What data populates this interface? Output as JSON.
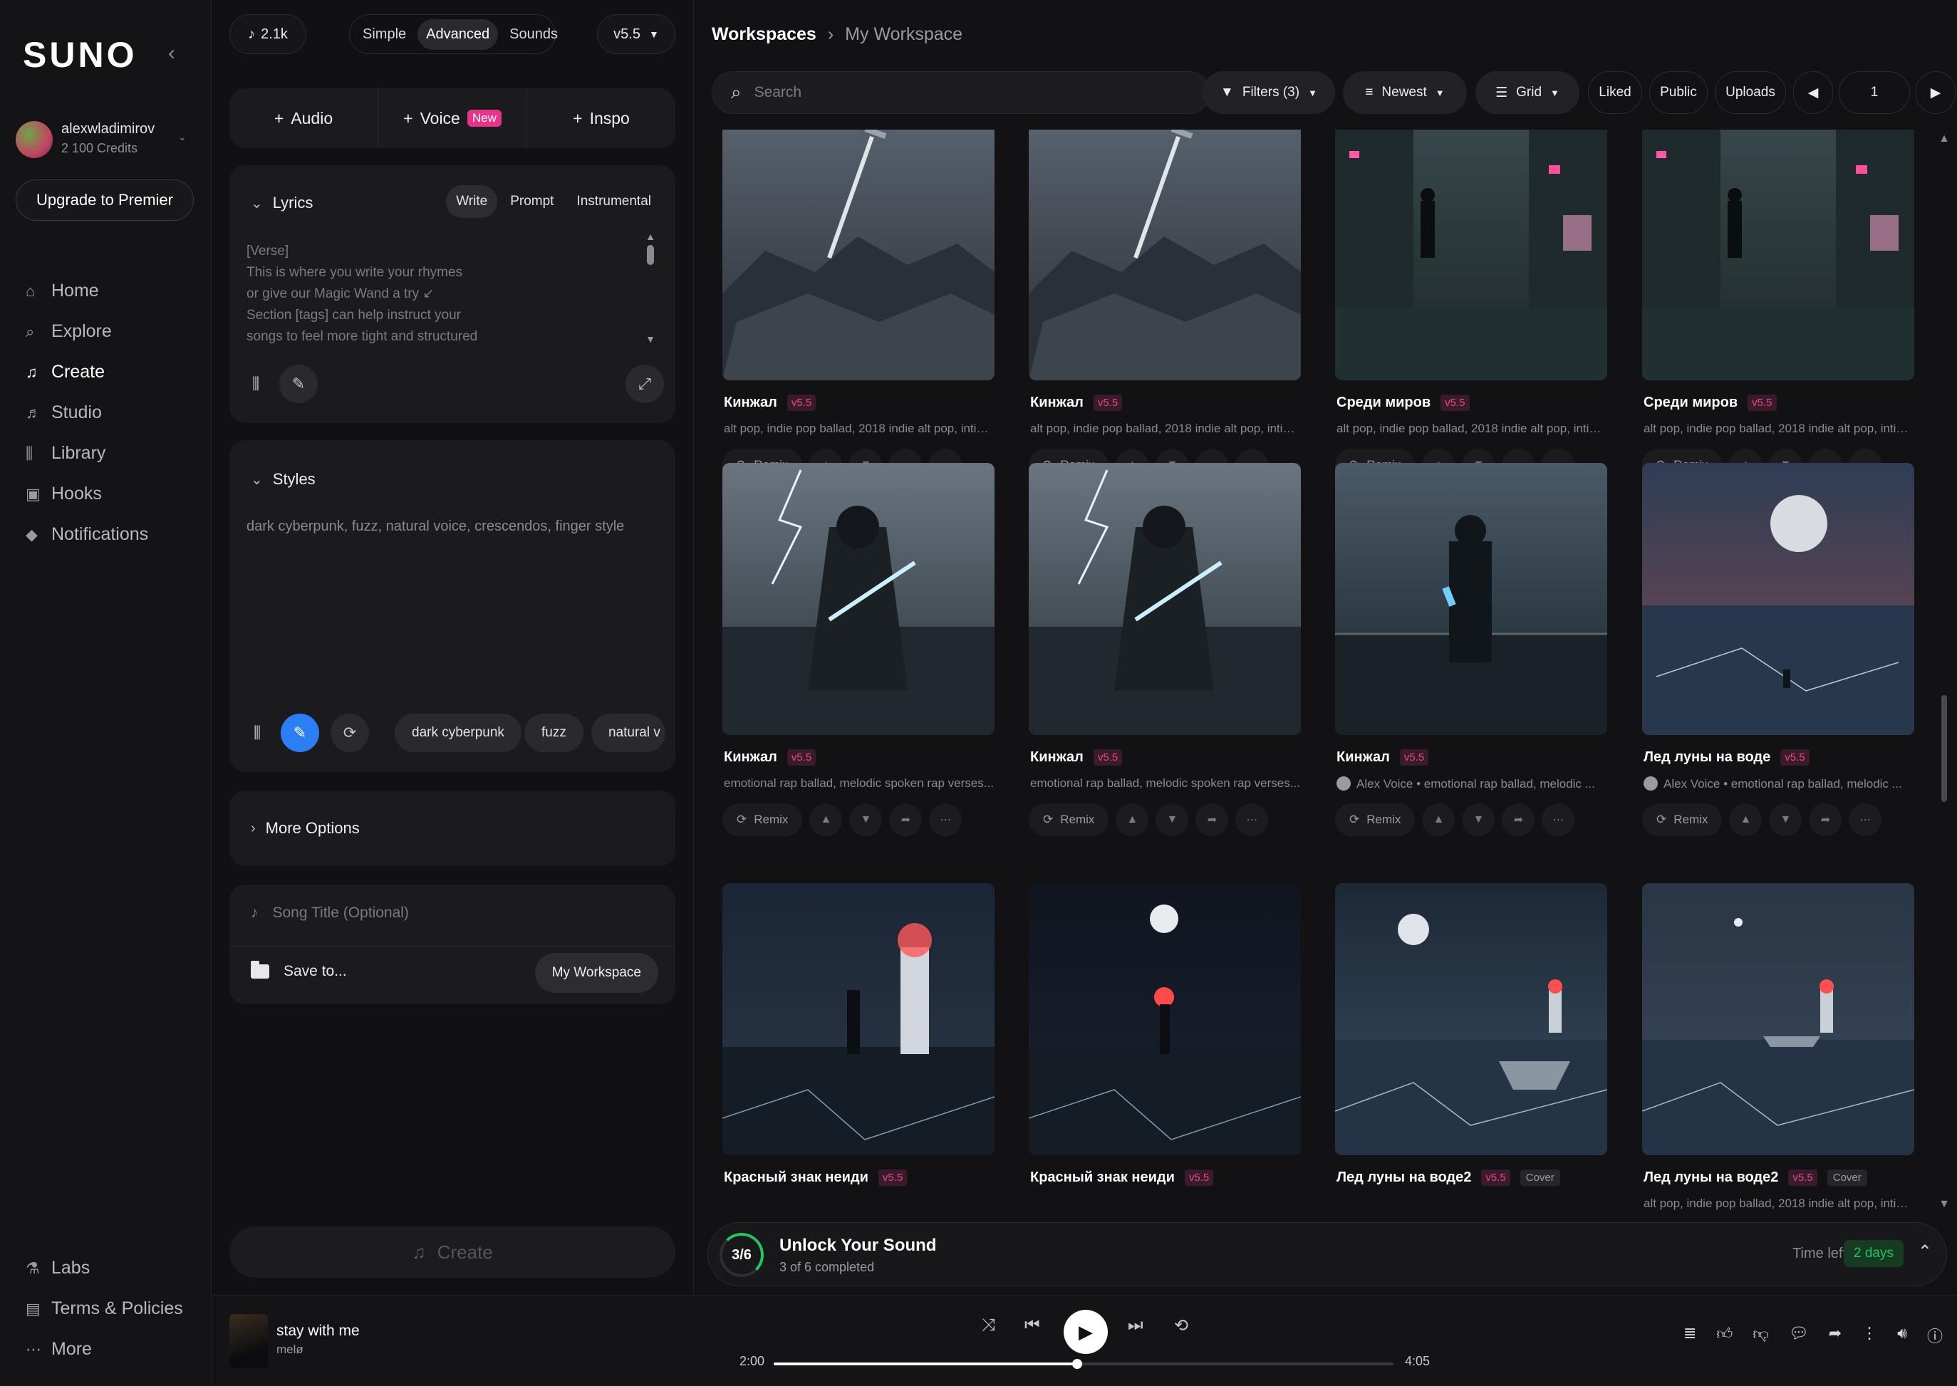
{
  "brand": {
    "logo": "SUNO"
  },
  "user": {
    "name": "alexwladimirov",
    "credits": "2 100 Credits"
  },
  "upgrade_label": "Upgrade to Premier",
  "nav": {
    "items": [
      {
        "label": "Home",
        "icon": "home-icon"
      },
      {
        "label": "Explore",
        "icon": "search-icon"
      },
      {
        "label": "Create",
        "icon": "music-note-icon"
      },
      {
        "label": "Studio",
        "icon": "studio-icon"
      },
      {
        "label": "Library",
        "icon": "library-icon"
      },
      {
        "label": "Hooks",
        "icon": "hooks-icon"
      },
      {
        "label": "Notifications",
        "icon": "bell-icon"
      }
    ],
    "bottom": [
      {
        "label": "Labs",
        "icon": "flask-icon"
      },
      {
        "label": "Terms & Policies",
        "icon": "document-icon"
      },
      {
        "label": "More",
        "icon": "more-icon"
      }
    ]
  },
  "create": {
    "count_badge": "2.1k",
    "modes": [
      "Simple",
      "Advanced",
      "Sounds"
    ],
    "active_mode": "Advanced",
    "version": "v5.5",
    "add": {
      "audio": "Audio",
      "voice": "Voice",
      "voice_badge": "New",
      "inspo": "Inspo"
    },
    "lyrics": {
      "title": "Lyrics",
      "tabs": [
        "Write",
        "Prompt",
        "Instrumental"
      ],
      "placeholder": "[Verse]\nThis is where you write your rhymes\nor give our Magic Wand a try ↙\nSection [tags] can help instruct your\nsongs to feel more tight and structured"
    },
    "styles": {
      "title": "Styles",
      "placeholder": "dark cyberpunk, fuzz, natural voice, crescendos, finger style",
      "chips": [
        "dark cyberpunk",
        "fuzz",
        "natural v"
      ]
    },
    "more_options": "More Options",
    "song_title_placeholder": "Song Title (Optional)",
    "save_to": "Save to...",
    "workspace": "My Workspace",
    "create_button": "Create"
  },
  "workspace": {
    "breadcrumb": [
      "Workspaces",
      "My Workspace"
    ],
    "search_placeholder": "Search",
    "filters": "Filters (3)",
    "sort": "Newest",
    "view": "Grid",
    "liked": "Liked",
    "public": "Public",
    "uploads": "Uploads",
    "page": "1",
    "remix_label": "Remix",
    "songs": [
      {
        "title": "Кинжал",
        "version": "v5.5",
        "desc": "alt pop, indie pop ballad, 2018 indie alt pop, intim...",
        "scene": "sword"
      },
      {
        "title": "Кинжал",
        "version": "v5.5",
        "desc": "alt pop, indie pop ballad, 2018 indie alt pop, intim...",
        "scene": "sword"
      },
      {
        "title": "Среди миров",
        "version": "v5.5",
        "desc": "alt pop, indie pop ballad, 2018 indie alt pop, intim...",
        "scene": "street"
      },
      {
        "title": "Среди миров",
        "version": "v5.5",
        "desc": "alt pop, indie pop ballad, 2018 indie alt pop, intim...",
        "scene": "street"
      },
      {
        "title": "Кинжал",
        "version": "v5.5",
        "desc": "emotional rap ballad, melodic spoken rap verses...",
        "scene": "hood"
      },
      {
        "title": "Кинжал",
        "version": "v5.5",
        "desc": "emotional rap ballad, melodic spoken rap verses...",
        "scene": "hood"
      },
      {
        "title": "Кинжал",
        "version": "v5.5",
        "voice": "Alex Voice",
        "desc": "emotional rap ballad, melodic ...",
        "scene": "glass"
      },
      {
        "title": "Лед луны на воде",
        "version": "v5.5",
        "voice": "Alex Voice",
        "desc": "emotional rap ballad, melodic ...",
        "scene": "moon"
      },
      {
        "title": "Красный знак неиди",
        "version": "v5.5",
        "desc": "",
        "scene": "lighthouse"
      },
      {
        "title": "Красный знак неиди",
        "version": "v5.5",
        "desc": "",
        "scene": "lighthouse2"
      },
      {
        "title": "Лед луны на воде2",
        "version": "v5.5",
        "cover": "Cover",
        "desc": "",
        "scene": "boat"
      },
      {
        "title": "Лед луны на воде2",
        "version": "v5.5",
        "cover": "Cover",
        "desc": "alt pop, indie pop ballad, 2018 indie alt pop, intim...",
        "scene": "pier"
      }
    ]
  },
  "unlock": {
    "progress": "3/6",
    "title": "Unlock Your Sound",
    "subtitle": "3 of 6 completed",
    "time_left_label": "Time left",
    "time_left": "2 days"
  },
  "player": {
    "title": "stay with me",
    "artist": "melø",
    "current": "2:00",
    "total": "4:05",
    "progress": 0.49
  },
  "colors": {
    "accent_blue": "#2b7ff5",
    "version_pink": "#e24a8a",
    "success_green": "#22c55e"
  }
}
